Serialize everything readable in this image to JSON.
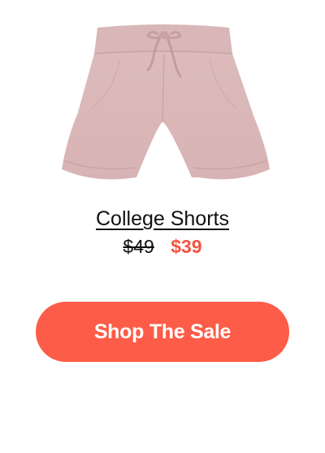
{
  "product": {
    "image_icon": "pink-shorts-image",
    "title": "College Shorts",
    "price_original": "$49",
    "price_sale": "$39"
  },
  "cta": {
    "label": "Shop The Sale"
  },
  "colors": {
    "accent": "#fd5c48",
    "sale_price": "#f25443",
    "garment": "#dcb9ba"
  }
}
